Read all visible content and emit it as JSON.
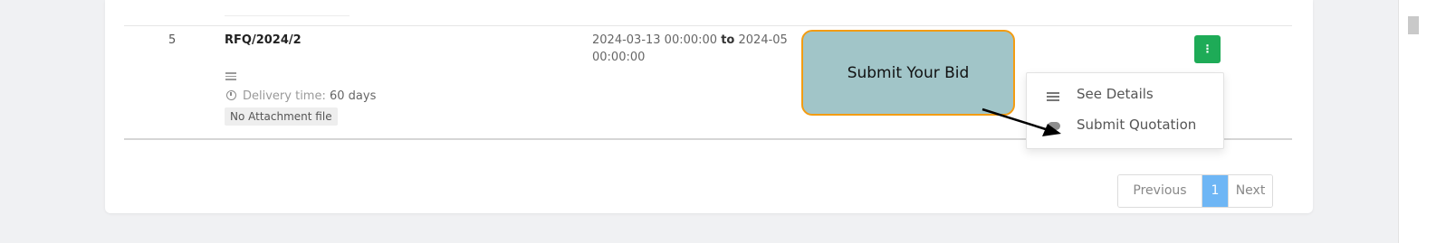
{
  "row": {
    "index": "5",
    "rfq_number": "RFQ/2024/2",
    "delivery_label": "Delivery time:",
    "delivery_value": "60 days",
    "attachment": "No Attachment file",
    "date_line1_start": "2024-03-13 00:00:00",
    "date_to": "to",
    "date_line1_end": "2024-05",
    "date_line2": "00:00:00",
    "action_glyph": "⋮"
  },
  "dropdown": {
    "items": [
      {
        "label": "See Details",
        "icon": "lines-icon"
      },
      {
        "label": "Submit Quotation",
        "icon": "cloud-upload-icon"
      }
    ]
  },
  "pagination": {
    "previous": "Previous",
    "current": "1",
    "next": "Next"
  },
  "callout": {
    "text": "Submit Your Bid"
  },
  "colors": {
    "action_button": "#1eab57",
    "current_page": "#6eb6f5",
    "callout_fill": "#a1c5c8",
    "callout_border": "#f39c12"
  }
}
